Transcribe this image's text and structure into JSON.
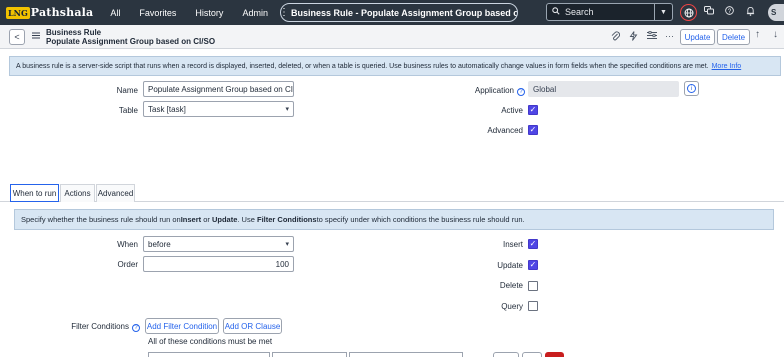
{
  "navbar": {
    "logo_mark": "LNG",
    "logo_text": "Pathshala",
    "links": [
      "All",
      "Favorites",
      "History",
      "Admin"
    ],
    "kebab": "⋮",
    "record_title": "Business Rule - Populate Assignment Group based on...",
    "star": "☆",
    "search_placeholder": "Search",
    "avatar_initials": "S"
  },
  "form_header": {
    "back": "<",
    "table_label": "Business Rule",
    "record_name": "Populate Assignment Group based on CI/SO",
    "more": "···",
    "update_label": "Update",
    "delete_label": "Delete",
    "up": "↑",
    "down": "↓"
  },
  "info_banner": {
    "text": "A business rule is a server-side script that runs when a record is displayed, inserted, deleted, or when a table is queried. Use business rules to automatically change values in form fields when the specified conditions are met.",
    "link": "More Info"
  },
  "fields": {
    "name_label": "Name",
    "name_value": "Populate Assignment Group based on CI/SO",
    "table_label": "Table",
    "table_value": "Task [task]",
    "application_label": "Application",
    "application_value": "Global",
    "active_label": "Active",
    "active_checked": true,
    "advanced_label": "Advanced",
    "advanced_checked": true
  },
  "tabs": [
    "When to run",
    "Actions",
    "Advanced"
  ],
  "when_to_run": {
    "banner_pre": "Specify whether the business rule should run on ",
    "insert_word": "Insert",
    "or_word": " or ",
    "update_word": "Update",
    "mid": ". Use ",
    "filter_word": "Filter Conditions",
    "banner_post": " to specify under which conditions the business rule should run.",
    "when_label": "When",
    "when_value": "before",
    "order_label": "Order",
    "order_value": "100",
    "insert_label": "Insert",
    "insert_checked": true,
    "update_label": "Update",
    "update_checked": true,
    "delete_label": "Delete",
    "delete_checked": false,
    "query_label": "Query",
    "query_checked": false,
    "filter_label": "Filter Conditions",
    "add_filter_label": "Add Filter Condition",
    "add_or_label": "Add OR Clause",
    "all_conditions_text": "All of these conditions must be met"
  }
}
